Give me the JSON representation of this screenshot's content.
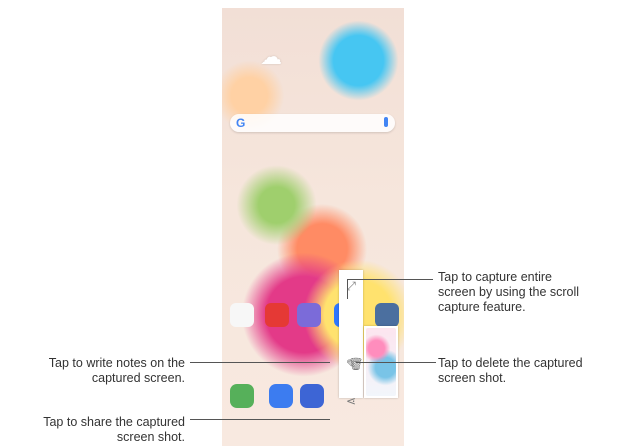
{
  "callouts": {
    "capture_entire": "Tap to capture entire\nscreen by using the scroll\ncapture feature.",
    "write_notes": "Tap to write notes on the\ncaptured screen.",
    "delete_capture": "Tap to delete the captured\nscreen shot.",
    "share_capture": "Tap to share the captured\nscreen shot."
  },
  "icons": {
    "weather": "cloud-icon",
    "search": "google-search-icon",
    "capture_entire": "expand-icon",
    "write_notes": "pen-icon",
    "delete": "trash-icon",
    "share": "share-icon"
  },
  "colors": {
    "line": "#555555",
    "text": "#333333"
  }
}
